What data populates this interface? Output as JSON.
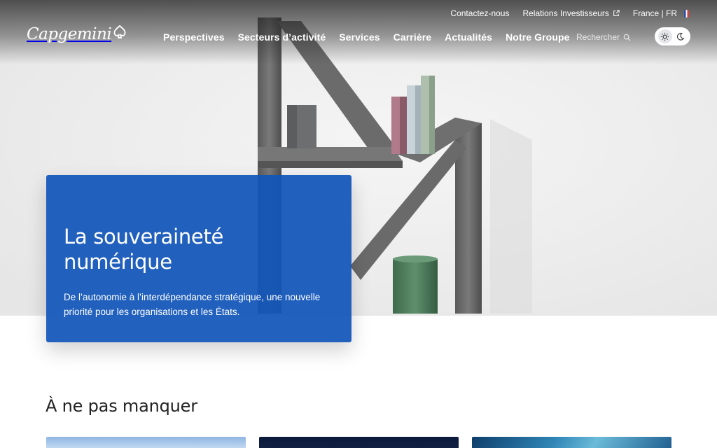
{
  "brand": {
    "logo_text": "Capgemini"
  },
  "utility_nav": {
    "contact": "Contactez-nous",
    "investors": "Relations Investisseurs",
    "locale": "France | FR"
  },
  "main_nav": {
    "items": [
      "Perspectives",
      "Secteurs d’activité",
      "Services",
      "Carrière",
      "Actualités",
      "Notre Groupe"
    ]
  },
  "search": {
    "label": "Rechercher"
  },
  "theme": {
    "active": "light"
  },
  "hero": {
    "title": "La souveraineté numérique",
    "subtitle": "De l’autonomie à l’interdépendance stratégique, une nouvelle priorité pour les organisations et les États."
  },
  "section": {
    "title": "À ne pas manquer"
  },
  "colors": {
    "brand_blue": "#1155B8",
    "text_dark": "#222222"
  }
}
